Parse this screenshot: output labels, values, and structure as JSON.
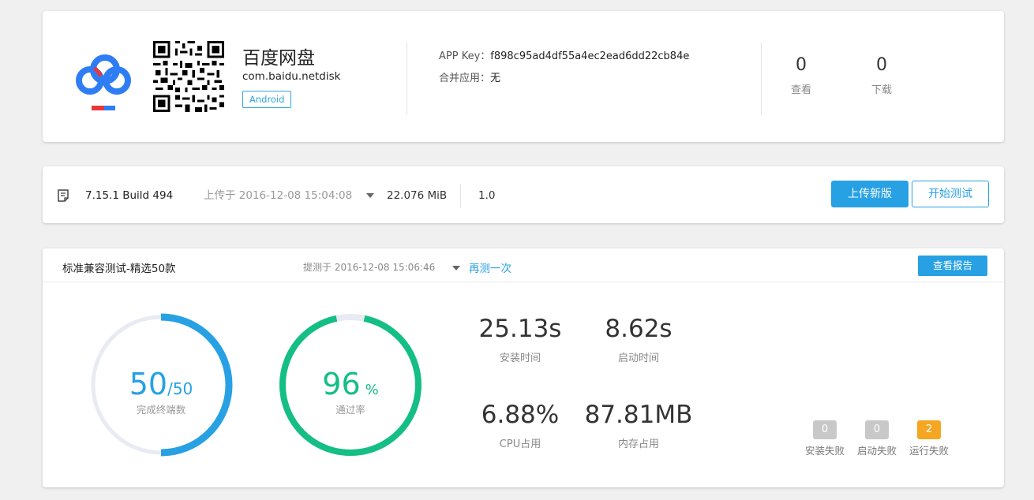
{
  "app": {
    "name": "百度网盘",
    "package": "com.baidu.netdisk",
    "platform": "Android",
    "app_key_label": "APP Key：",
    "app_key_value": "f898c95ad4df55a4ec2ead6dd22cb84e",
    "merge_label": "合并应用：",
    "merge_value": "无",
    "views_value": "0",
    "views_label": "查看",
    "downloads_value": "0",
    "downloads_label": "下载",
    "logo_icon": "baidu-cloud-logo-icon",
    "qr_icon": "qr-code-icon"
  },
  "build": {
    "version": "7.15.1 Build 494",
    "uploaded": "上传于 2016-12-08 15:04:08",
    "size": "22.076 MiB",
    "version_code": "1.0",
    "upload_button": "上传新版",
    "start_test_button": "开始测试",
    "doc_icon": "document-icon"
  },
  "test": {
    "title": "标准兼容测试-精选50款",
    "submitted": "提测于 2016-12-08 15:06:46",
    "retest": "再测一次",
    "report_button": "查看报告",
    "completed_value": "50",
    "completed_total": "/50",
    "completed_label": "完成终端数",
    "pass_value": "96",
    "pass_unit": "%",
    "pass_label": "通过率",
    "install_time_value": "25.13s",
    "install_time_label": "安装时间",
    "launch_time_value": "8.62s",
    "launch_time_label": "启动时间",
    "cpu_value": "6.88%",
    "cpu_label": "CPU占用",
    "memory_value": "87.81MB",
    "memory_label": "内存占用",
    "install_fail_value": "0",
    "install_fail_label": "安装失败",
    "launch_fail_value": "0",
    "launch_fail_label": "启动失败",
    "run_fail_value": "2",
    "run_fail_label": "运行失败",
    "completed_fraction": 1.0,
    "pass_fraction": 0.96
  },
  "colors": {
    "accent": "#27a1e4",
    "pass_green": "#14be84",
    "warning": "#f5a623",
    "neutral_badge": "#c8c8c8"
  }
}
